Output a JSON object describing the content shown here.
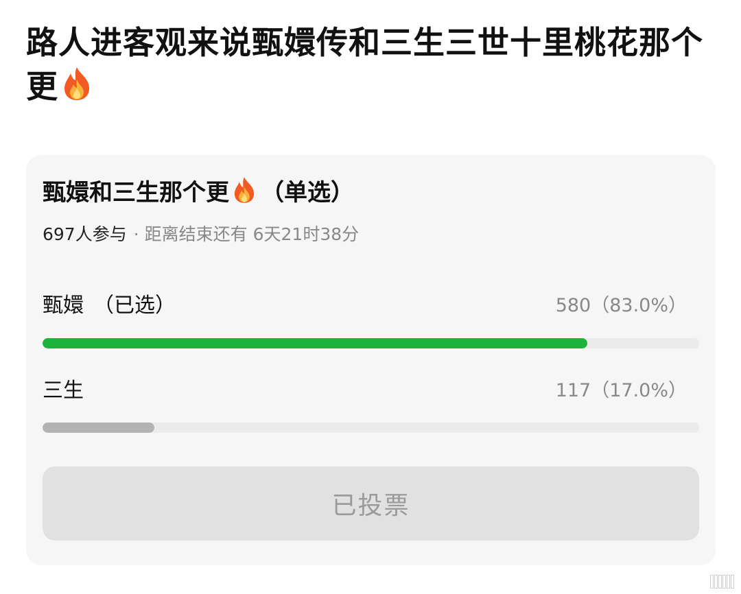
{
  "post": {
    "title": "路人进客观来说甄嬛传和三生三世十里桃花那个更",
    "title_icon": "fire-icon"
  },
  "poll": {
    "title": "甄嬛和三生那个更",
    "title_icon": "fire-icon",
    "type_label": "（单选）",
    "participants": "697人参与",
    "separator": "·",
    "time_remaining": "距离结束还有 6天21时38分",
    "options": [
      {
        "label": "甄嬛",
        "selected_tag": "（已选）",
        "result": "580（83.0%）",
        "votes": 580,
        "percent": 83.0,
        "bar_color": "#1db33b"
      },
      {
        "label": "三生",
        "selected_tag": "",
        "result": "117（17.0%）",
        "votes": 117,
        "percent": 17.0,
        "bar_color": "#b3b3b3"
      }
    ],
    "vote_button_label": "已投票"
  },
  "colors": {
    "card_background": "#f6f6f6",
    "track": "#ebebeb",
    "selected_bar": "#1db33b",
    "other_bar": "#b3b3b3",
    "button_background": "#e1e1e1",
    "button_text": "#9a9a9a"
  }
}
